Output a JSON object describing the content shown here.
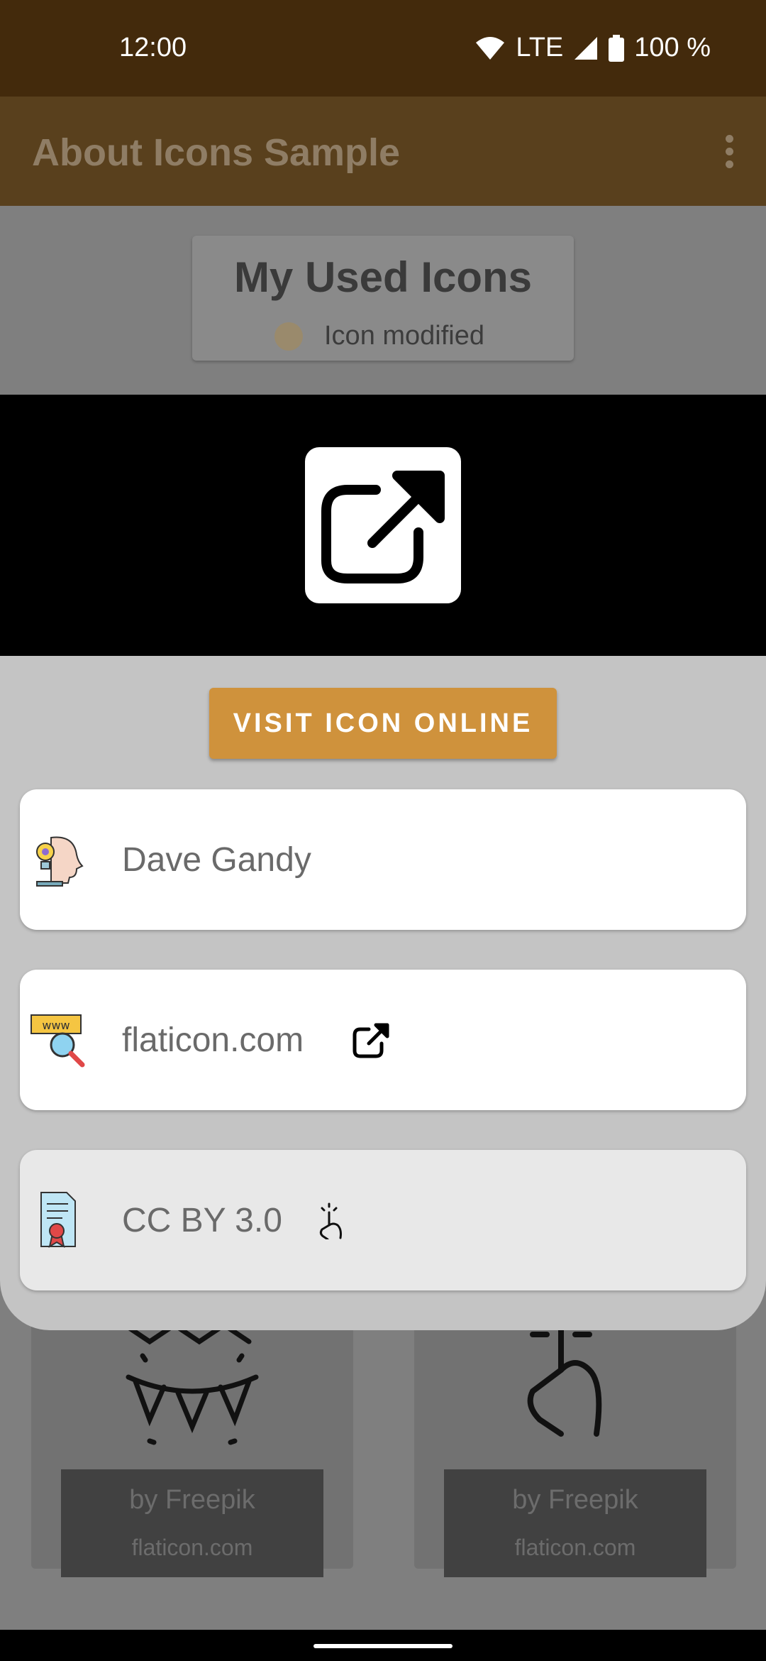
{
  "status_bar": {
    "time": "12:00",
    "network": "LTE",
    "battery": "100 %"
  },
  "app_bar": {
    "title": "About Icons Sample"
  },
  "legend": {
    "title": "My Used Icons",
    "modified_label": "Icon modified"
  },
  "grid": [
    {
      "by": "by Freepik",
      "site": "flaticon.com"
    },
    {
      "by": "by Freepik",
      "site": "flaticon.com"
    }
  ],
  "dialog": {
    "visit_button": "VISIT ICON ONLINE",
    "author": "Dave Gandy",
    "website": "flaticon.com",
    "license": "CC BY 3.0"
  },
  "colors": {
    "accent": "#cf923c",
    "status_bar": "#432a0c",
    "app_bar": "#59401d"
  }
}
